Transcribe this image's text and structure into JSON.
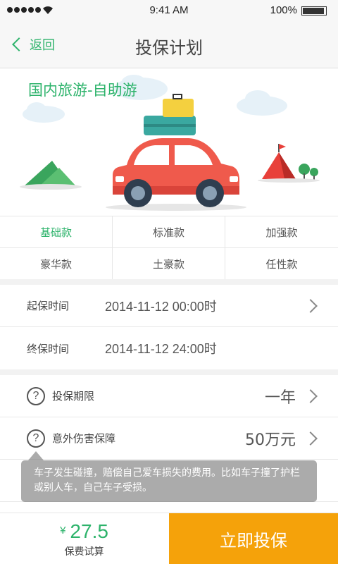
{
  "status_bar": {
    "time": "9:41 AM",
    "battery": "100%",
    "icons": [
      "signal-icon",
      "wifi-icon",
      "battery-icon"
    ]
  },
  "nav": {
    "back_label": "返回",
    "title": "投保计划"
  },
  "banner": {
    "title": "国内旅游-自助游"
  },
  "plans": [
    {
      "label": "基础款",
      "selected": true
    },
    {
      "label": "标准款",
      "selected": false
    },
    {
      "label": "加强款",
      "selected": false
    },
    {
      "label": "豪华款",
      "selected": false
    },
    {
      "label": "土豪款",
      "selected": false
    },
    {
      "label": "任性款",
      "selected": false
    }
  ],
  "dates": {
    "start_label": "起保时间",
    "start_value": "2014-11-12 00:00时",
    "end_label": "终保时间",
    "end_value": "2014-11-12 24:00时"
  },
  "coverage": {
    "term_label": "投保期限",
    "term_value": "一年",
    "injury_label": "意外伤害保障",
    "injury_value": "50万元"
  },
  "tooltip": {
    "text": "车子发生碰撞，赔偿自己爱车损失的费用。比如车子撞了护栏或别人车，自己车子受损。"
  },
  "footer": {
    "currency": "¥",
    "price": "27.5",
    "price_label": "保费试算",
    "buy_label": "立即投保"
  },
  "colors": {
    "accent": "#2db36b",
    "buy_button": "#f5a20a"
  }
}
